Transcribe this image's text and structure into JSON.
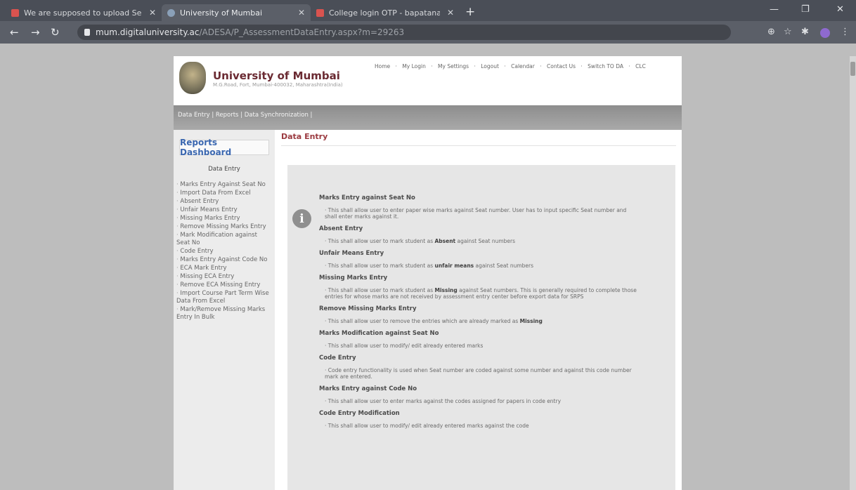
{
  "browser": {
    "tabs": [
      {
        "label": "We are supposed to upload Ser",
        "icon": "gmail-icon"
      },
      {
        "label": "University of Mumbai",
        "icon": "globe-icon"
      },
      {
        "label": "College login OTP - bapatanagi",
        "icon": "gmail-icon"
      }
    ],
    "url_domain": "mum.digitaluniversity.ac",
    "url_path": "/ADESA/P_AssessmentDataEntry.aspx?m=29263"
  },
  "header": {
    "title": "University of Mumbai",
    "subtitle": "M.G.Road, Fort, Mumbai-400032, Maharashtra(India)",
    "links": [
      "Home",
      "My Login",
      "My Settings",
      "Logout",
      "Calendar",
      "Contact Us",
      "Switch TO DA",
      "CLC"
    ]
  },
  "menubar": {
    "text": "Data Entry | Reports | Data Synchronization |"
  },
  "sidebar": {
    "title": "Reports Dashboard",
    "section": "Data Entry",
    "items": [
      "Marks Entry Against Seat No",
      "Import Data From Excel",
      "Absent Entry",
      "Unfair Means Entry",
      "Missing Marks Entry",
      "Remove Missing Marks Entry",
      "Mark Modification against Seat No",
      "Code Entry",
      "Marks Entry Against Code No",
      "ECA Mark Entry",
      "Missing ECA Entry",
      "Remove ECA Missing Entry",
      "Import Course Part Term Wise Data From Excel",
      "Mark/Remove Missing Marks Entry In Bulk"
    ]
  },
  "content": {
    "title": "Data Entry",
    "entries": [
      {
        "heading": "Marks Entry against Seat No",
        "text": "This shall allow user to enter paper wise marks against Seat number. User has to input specific Seat number and shall enter marks against it."
      },
      {
        "heading": "Absent Entry",
        "pre": "This shall allow user to mark student as ",
        "bold": "Absent",
        "post": " against Seat numbers"
      },
      {
        "heading": "Unfair Means Entry",
        "pre": "This shall allow user to mark student as ",
        "bold": "unfair means",
        "post": " against Seat numbers"
      },
      {
        "heading": "Missing Marks Entry",
        "pre": "This shall allow user to mark student as ",
        "bold": "Missing",
        "post": " against Seat numbers. This is generally required to complete those entries for whose marks are not received by assessment entry center before export data for SRPS"
      },
      {
        "heading": "Remove Missing Marks Entry",
        "pre": "This shall allow user to remove the entries which are already marked as ",
        "bold": "Missing",
        "post": ""
      },
      {
        "heading": "Marks Modification against Seat No",
        "text": "This shall allow user to modify/ edit already entered marks"
      },
      {
        "heading": "Code Entry",
        "text": "Code entry functionality is used when Seat number are coded against some number and against this code number mark are entered."
      },
      {
        "heading": "Marks Entry against Code No",
        "text": "This shall allow user to enter marks against the codes assigned for papers in code entry"
      },
      {
        "heading": "Code Entry Modification",
        "text": "This shall allow user to modify/ edit already entered marks against the code"
      }
    ]
  }
}
